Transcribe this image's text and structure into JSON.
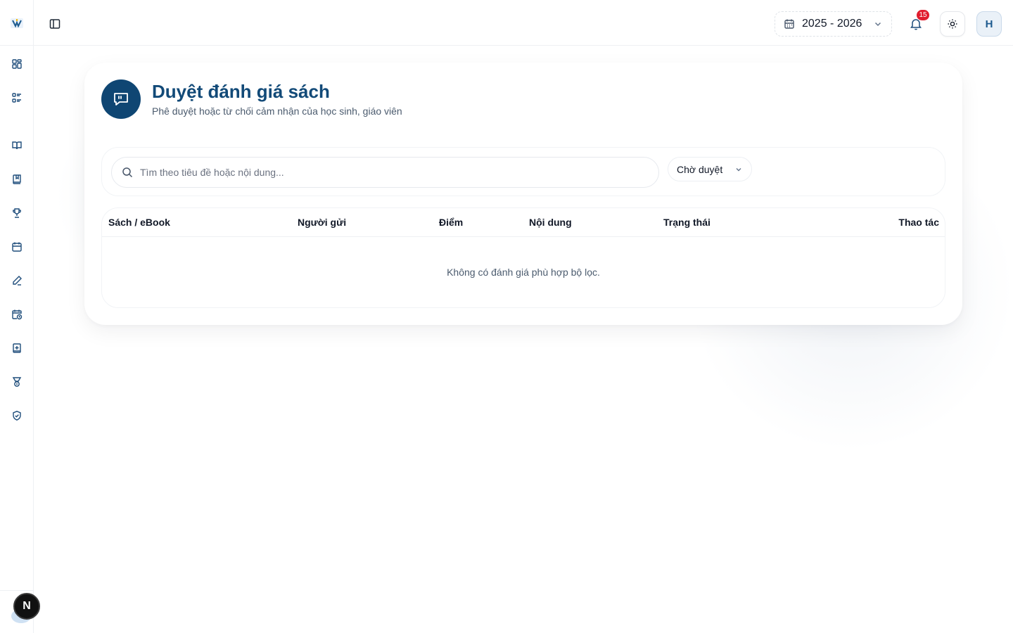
{
  "header": {
    "school_year": "2025 - 2026",
    "notification_count": "15",
    "avatar_initial": "H"
  },
  "page": {
    "title": "Duyệt đánh giá sách",
    "subtitle": "Phê duyệt hoặc từ chối cảm nhận của học sinh, giáo viên"
  },
  "filters": {
    "search_placeholder": "Tìm theo tiêu đề hoặc nội dung...",
    "status_value": "Chờ duyệt"
  },
  "table": {
    "columns": [
      "Sách / eBook",
      "Người gửi",
      "Điểm",
      "Nội dung",
      "Trạng thái",
      "Thao tác"
    ],
    "empty_message": "Không có đánh giá phù hợp bộ lọc."
  },
  "sidebar": {
    "icons": [
      "dashboard-icon",
      "list-icon",
      "book-open-icon",
      "book-icon",
      "trophy-icon",
      "calendar-icon",
      "pen-icon",
      "calendar-clock-icon",
      "book-plus-icon",
      "medal-icon",
      "shield-check-icon"
    ]
  },
  "dev_badge": "N",
  "colors": {
    "brand": "#0f4673",
    "title": "#124a78",
    "badge": "#e11d2e"
  }
}
